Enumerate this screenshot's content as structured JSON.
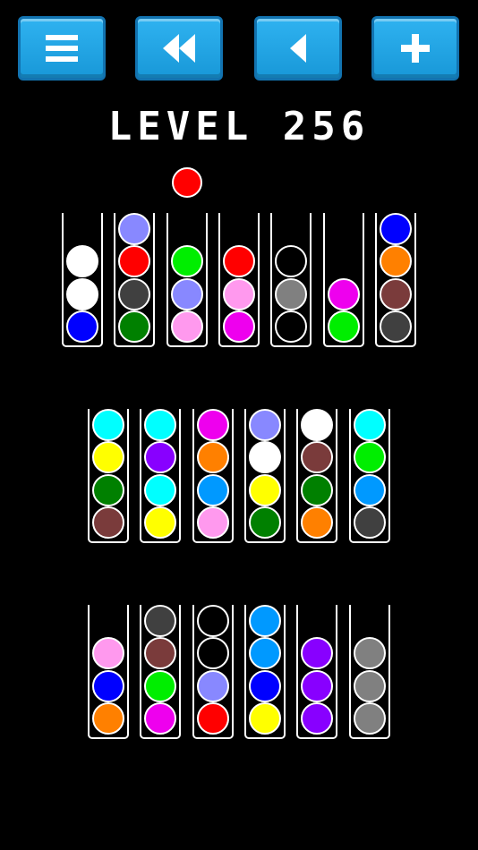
{
  "toolbar": {
    "buttons": [
      {
        "name": "menu-button",
        "icon": "menu-icon"
      },
      {
        "name": "restart-button",
        "icon": "rewind-icon"
      },
      {
        "name": "undo-button",
        "icon": "back-arrow-icon"
      },
      {
        "name": "add-tube-button",
        "icon": "plus-icon"
      }
    ],
    "accent_color": "#1ea3e5"
  },
  "level": {
    "title": "LEVEL 256"
  },
  "held_ball": {
    "color": "#ff0000",
    "above_tube": 3
  },
  "rows": [
    {
      "tubes": [
        {
          "balls": [
            "#0000ff",
            "#ffffff",
            "#ffffff"
          ]
        },
        {
          "balls": [
            "#008000",
            "#404040",
            "#ff0000",
            "#8888ff"
          ]
        },
        {
          "balls": [
            "#ff99ee",
            "#8888ff",
            "#00ee00"
          ]
        },
        {
          "balls": [
            "#ee00ee",
            "#ff99ee",
            "#ff0000"
          ]
        },
        {
          "balls": [
            "#000000",
            "#808080",
            "#000000"
          ]
        },
        {
          "balls": [
            "#00ee00",
            "#ee00ee"
          ]
        },
        {
          "balls": [
            "#404040",
            "#7a3b3b",
            "#ff8000",
            "#0000ff"
          ]
        }
      ]
    },
    {
      "tubes": [
        {
          "balls": [
            "#7a3b3b",
            "#008000",
            "#ffff00",
            "#00ffff"
          ]
        },
        {
          "balls": [
            "#ffff00",
            "#00ffff",
            "#8800ff",
            "#00ffff"
          ]
        },
        {
          "balls": [
            "#ff99ee",
            "#0099ff",
            "#ff8000",
            "#ee00ee"
          ]
        },
        {
          "balls": [
            "#008000",
            "#ffff00",
            "#ffffff",
            "#8888ff"
          ]
        },
        {
          "balls": [
            "#ff8000",
            "#008000",
            "#7a3b3b",
            "#ffffff"
          ]
        },
        {
          "balls": [
            "#404040",
            "#0099ff",
            "#00ee00",
            "#00ffff"
          ]
        }
      ]
    },
    {
      "tubes": [
        {
          "balls": [
            "#ff8000",
            "#0000ff",
            "#ff99ee"
          ]
        },
        {
          "balls": [
            "#ee00ee",
            "#00ee00",
            "#7a3b3b",
            "#404040"
          ]
        },
        {
          "balls": [
            "#ff0000",
            "#8888ff",
            "#000000",
            "#000000"
          ]
        },
        {
          "balls": [
            "#ffff00",
            "#0000ff",
            "#0099ff",
            "#0099ff"
          ]
        },
        {
          "balls": [
            "#8800ff",
            "#8800ff",
            "#8800ff"
          ]
        },
        {
          "balls": [
            "#808080",
            "#808080",
            "#808080"
          ]
        }
      ]
    }
  ]
}
